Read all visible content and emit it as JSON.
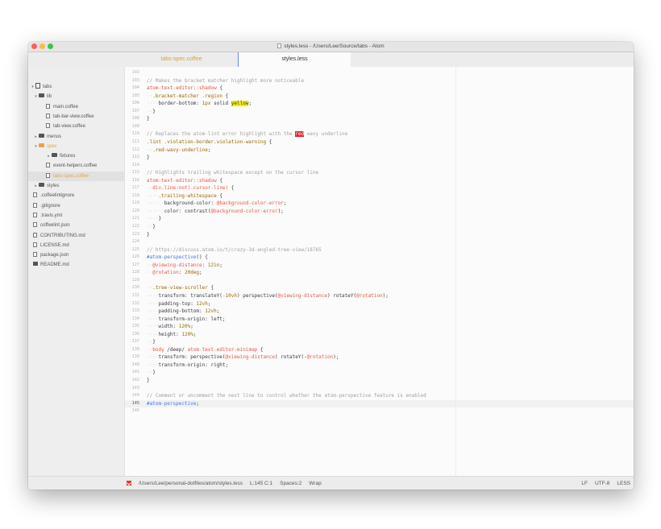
{
  "window": {
    "title": "styles.less - /Users/Lee/Source/tabs - Atom",
    "traffic_lights": [
      "#fc605c",
      "#fdbc40",
      "#34c84a"
    ]
  },
  "tabs": [
    {
      "label": "tabs-spec.coffee",
      "active": false
    },
    {
      "label": "styles.less",
      "active": true
    }
  ],
  "tree": [
    {
      "label": "tabs",
      "depth": 0,
      "kind": "repo",
      "arrow": "▾"
    },
    {
      "label": "lib",
      "depth": 1,
      "kind": "folder",
      "arrow": "▾"
    },
    {
      "label": "main.coffee",
      "depth": 2,
      "kind": "file"
    },
    {
      "label": "tab-bar-view.coffee",
      "depth": 2,
      "kind": "file"
    },
    {
      "label": "tab-view.coffee",
      "depth": 2,
      "kind": "file"
    },
    {
      "label": "menus",
      "depth": 1,
      "kind": "folder",
      "arrow": "▸"
    },
    {
      "label": "spec",
      "depth": 1,
      "kind": "folder",
      "arrow": "▾",
      "selected": true
    },
    {
      "label": "fixtures",
      "depth": 2,
      "kind": "folder",
      "arrow": "▸"
    },
    {
      "label": "event-helpers.coffee",
      "depth": 2,
      "kind": "file"
    },
    {
      "label": "tabs-spec.coffee",
      "depth": 2,
      "kind": "file",
      "selected": true
    },
    {
      "label": "styles",
      "depth": 1,
      "kind": "folder",
      "arrow": "▸"
    },
    {
      "label": ".coffeelintignore",
      "depth": 1,
      "kind": "file"
    },
    {
      "label": ".gitignore",
      "depth": 1,
      "kind": "file"
    },
    {
      "label": ".travis.yml",
      "depth": 1,
      "kind": "file"
    },
    {
      "label": "coffeelint.json",
      "depth": 1,
      "kind": "file"
    },
    {
      "label": "CONTRIBUTING.md",
      "depth": 1,
      "kind": "file"
    },
    {
      "label": "LICENSE.md",
      "depth": 1,
      "kind": "file"
    },
    {
      "label": "package.json",
      "depth": 1,
      "kind": "file"
    },
    {
      "label": "README.md",
      "depth": 1,
      "kind": "book"
    }
  ],
  "editor": {
    "current_line": 145,
    "lines": [
      {
        "n": 102,
        "t": [
          [
            "",
            ""
          ]
        ]
      },
      {
        "n": 103,
        "t": [
          [
            "// Makes the bracket matcher highlight more noticeable",
            "comment"
          ]
        ]
      },
      {
        "n": 104,
        "t": [
          [
            "atom-text-editor::shadow",
            "sel"
          ],
          [
            " {",
            ""
          ]
        ]
      },
      {
        "n": 105,
        "t": [
          [
            "··",
            "ind"
          ],
          [
            ".bracket-matcher .region",
            "cls"
          ],
          [
            " {",
            ""
          ]
        ]
      },
      {
        "n": 106,
        "t": [
          [
            "····",
            "ind"
          ],
          [
            "border-bottom: ",
            "prop"
          ],
          [
            "1px",
            "num"
          ],
          [
            " solid ",
            ""
          ],
          [
            "yellow",
            "hl"
          ],
          [
            ";",
            ""
          ]
        ]
      },
      {
        "n": 107,
        "t": [
          [
            "··",
            "ind"
          ],
          [
            "}",
            ""
          ]
        ]
      },
      {
        "n": 108,
        "t": [
          [
            "}",
            ""
          ]
        ]
      },
      {
        "n": 109,
        "t": [
          [
            "",
            ""
          ]
        ]
      },
      {
        "n": 110,
        "t": [
          [
            "// Replaces the atom-lint error highlight with the ",
            "comment"
          ],
          [
            "red",
            "red"
          ],
          [
            " wavy underline",
            "comment"
          ]
        ]
      },
      {
        "n": 111,
        "t": [
          [
            ".lint .violation-border.violation-warning",
            "cls"
          ],
          [
            " {",
            ""
          ]
        ]
      },
      {
        "n": 112,
        "t": [
          [
            "··",
            "ind"
          ],
          [
            ".red-wavy-underline",
            "cls"
          ],
          [
            ";",
            ""
          ]
        ]
      },
      {
        "n": 113,
        "t": [
          [
            "}",
            ""
          ]
        ]
      },
      {
        "n": 114,
        "t": [
          [
            "",
            ""
          ]
        ]
      },
      {
        "n": 115,
        "t": [
          [
            "// Highlights trailing whitespace except on the cursor line",
            "comment"
          ]
        ]
      },
      {
        "n": 116,
        "t": [
          [
            "atom-text-editor::shadow",
            "sel"
          ],
          [
            " {",
            ""
          ]
        ]
      },
      {
        "n": 117,
        "t": [
          [
            "··",
            "ind"
          ],
          [
            "div.line:not(.cursor-line)",
            "sel"
          ],
          [
            " {",
            ""
          ]
        ]
      },
      {
        "n": 118,
        "t": [
          [
            "····",
            "ind"
          ],
          [
            ".trailing-whitespace",
            "cls"
          ],
          [
            " {",
            ""
          ]
        ]
      },
      {
        "n": 119,
        "t": [
          [
            "······",
            "ind"
          ],
          [
            "background-color: ",
            "prop"
          ],
          [
            "@background-color-error",
            "var"
          ],
          [
            ";",
            ""
          ]
        ]
      },
      {
        "n": 120,
        "t": [
          [
            "······",
            "ind"
          ],
          [
            "color: contrast(",
            "prop"
          ],
          [
            "@background-color-error",
            "var"
          ],
          [
            ");",
            ""
          ]
        ]
      },
      {
        "n": 121,
        "t": [
          [
            "····",
            "ind"
          ],
          [
            "}",
            ""
          ]
        ]
      },
      {
        "n": 122,
        "t": [
          [
            "··",
            "ind"
          ],
          [
            "}",
            ""
          ]
        ]
      },
      {
        "n": 123,
        "t": [
          [
            "}",
            ""
          ]
        ]
      },
      {
        "n": 124,
        "t": [
          [
            "",
            ""
          ]
        ]
      },
      {
        "n": 125,
        "t": [
          [
            "// https://discuss.atom.io/t/crazy-3d-angled-tree-view/18765",
            "comment"
          ]
        ]
      },
      {
        "n": 126,
        "t": [
          [
            "#atom-perspective",
            "fn"
          ],
          [
            "() {",
            ""
          ]
        ]
      },
      {
        "n": 127,
        "t": [
          [
            "··",
            "ind"
          ],
          [
            "@viewing-distance",
            "var"
          ],
          [
            ": ",
            ""
          ],
          [
            "12in",
            "num"
          ],
          [
            ";",
            ""
          ]
        ]
      },
      {
        "n": 128,
        "t": [
          [
            "··",
            "ind"
          ],
          [
            "@rotation",
            "var"
          ],
          [
            ": ",
            ""
          ],
          [
            "20deg",
            "num"
          ],
          [
            ";",
            ""
          ]
        ]
      },
      {
        "n": 129,
        "t": [
          [
            "",
            ""
          ]
        ]
      },
      {
        "n": 130,
        "t": [
          [
            "··",
            "ind"
          ],
          [
            ".tree-view-scroller",
            "cls"
          ],
          [
            " {",
            ""
          ]
        ]
      },
      {
        "n": 131,
        "t": [
          [
            "····",
            "ind"
          ],
          [
            "transform: translateY(",
            "prop"
          ],
          [
            "-10vh",
            "num"
          ],
          [
            ") perspective(",
            ""
          ],
          [
            "@viewing-distance",
            "var"
          ],
          [
            ") rotateY(",
            ""
          ],
          [
            "@rotation",
            "var"
          ],
          [
            ");",
            ""
          ]
        ]
      },
      {
        "n": 132,
        "t": [
          [
            "····",
            "ind"
          ],
          [
            "padding-top: ",
            "prop"
          ],
          [
            "12vh",
            "num"
          ],
          [
            ";",
            ""
          ]
        ]
      },
      {
        "n": 133,
        "t": [
          [
            "····",
            "ind"
          ],
          [
            "padding-bottom: ",
            "prop"
          ],
          [
            "12vh",
            "num"
          ],
          [
            ";",
            ""
          ]
        ]
      },
      {
        "n": 134,
        "t": [
          [
            "····",
            "ind"
          ],
          [
            "transform-origin: left;",
            "prop"
          ]
        ]
      },
      {
        "n": 135,
        "t": [
          [
            "····",
            "ind"
          ],
          [
            "width: ",
            "prop"
          ],
          [
            "120%",
            "num"
          ],
          [
            ";",
            ""
          ]
        ]
      },
      {
        "n": 136,
        "t": [
          [
            "····",
            "ind"
          ],
          [
            "height: ",
            "prop"
          ],
          [
            "120%",
            "num"
          ],
          [
            ";",
            ""
          ]
        ]
      },
      {
        "n": 137,
        "t": [
          [
            "··",
            "ind"
          ],
          [
            "}",
            ""
          ]
        ]
      },
      {
        "n": 138,
        "t": [
          [
            "··",
            "ind"
          ],
          [
            "body",
            "sel"
          ],
          [
            " /deep/ ",
            ""
          ],
          [
            "atom-text-editor-minimap",
            "sel"
          ],
          [
            " {",
            ""
          ]
        ]
      },
      {
        "n": 139,
        "t": [
          [
            "····",
            "ind"
          ],
          [
            "transform: perspective(",
            "prop"
          ],
          [
            "@viewing-distance",
            "var"
          ],
          [
            ") rotateY(-",
            ""
          ],
          [
            "@rotation",
            "var"
          ],
          [
            ");",
            ""
          ]
        ]
      },
      {
        "n": 140,
        "t": [
          [
            "····",
            "ind"
          ],
          [
            "transform-origin: right;",
            "prop"
          ]
        ]
      },
      {
        "n": 141,
        "t": [
          [
            "··",
            "ind"
          ],
          [
            "}",
            ""
          ]
        ]
      },
      {
        "n": 142,
        "t": [
          [
            "}",
            ""
          ]
        ]
      },
      {
        "n": 143,
        "t": [
          [
            "",
            ""
          ]
        ]
      },
      {
        "n": 144,
        "t": [
          [
            "// Comment or uncomment the next line to control whether the atom-perspective feature is enabled",
            "comment"
          ]
        ]
      },
      {
        "n": 145,
        "t": [
          [
            "#atom-perspective",
            "fn"
          ],
          [
            ";",
            ""
          ]
        ]
      },
      {
        "n": 146,
        "t": [
          [
            "",
            ""
          ]
        ]
      }
    ]
  },
  "status": {
    "path": "/Users/Lee/personal-dotfiles/atom/styles.less",
    "cursor": "L:145 C:1",
    "spaces": "Spaces:2",
    "wrap": "Wrap",
    "line_ending": "LF",
    "encoding": "UTF-8",
    "grammar": "LESS"
  }
}
